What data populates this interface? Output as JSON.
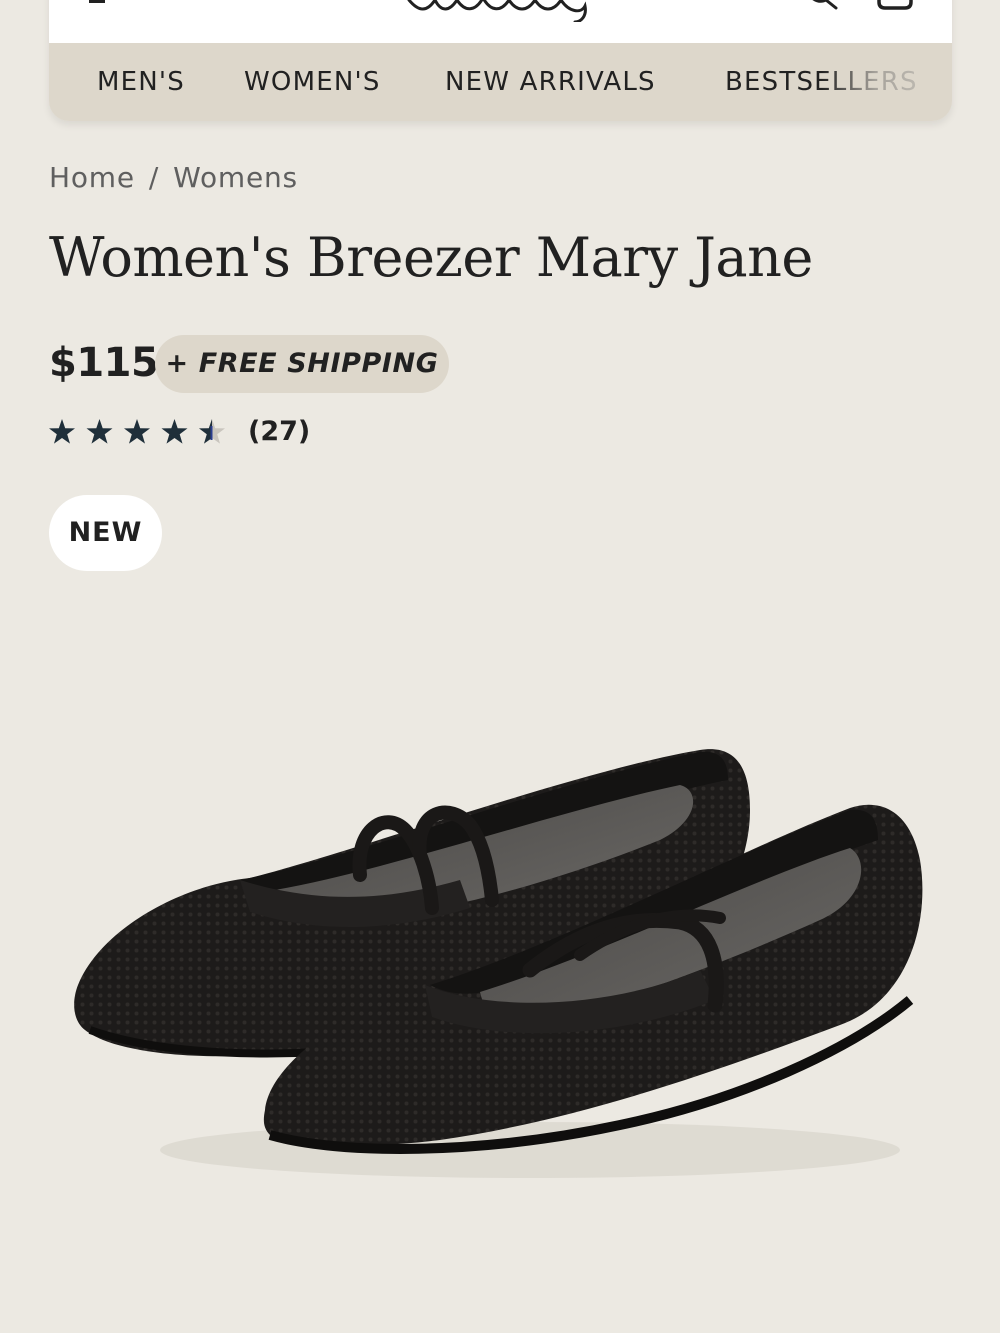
{
  "header": {
    "logo_text": "allbirds",
    "icons": {
      "menu": "hamburger-menu-icon",
      "search": "search-icon",
      "cart": "cart-icon"
    },
    "nav": [
      {
        "label": "MEN'S"
      },
      {
        "label": "WOMEN'S"
      },
      {
        "label": "NEW ARRIVALS"
      },
      {
        "label": "BESTSELLERS"
      }
    ]
  },
  "breadcrumb": {
    "items": [
      "Home",
      "Womens"
    ],
    "separator": "/"
  },
  "product": {
    "title": "Women's Breezer Mary Jane",
    "price": "$115",
    "shipping_badge": "+ FREE SHIPPING",
    "rating": {
      "value": 4.5,
      "max": 5,
      "count_label": "(27)"
    },
    "badge": "NEW",
    "image_icon": "black-knit-mary-jane-flats-pair"
  },
  "colors": {
    "background": "#ece9e2",
    "nav_background": "#ddd7cb",
    "text": "#212121",
    "star": "#1f2f3a",
    "star_half_accent": "#2a3d8f"
  }
}
